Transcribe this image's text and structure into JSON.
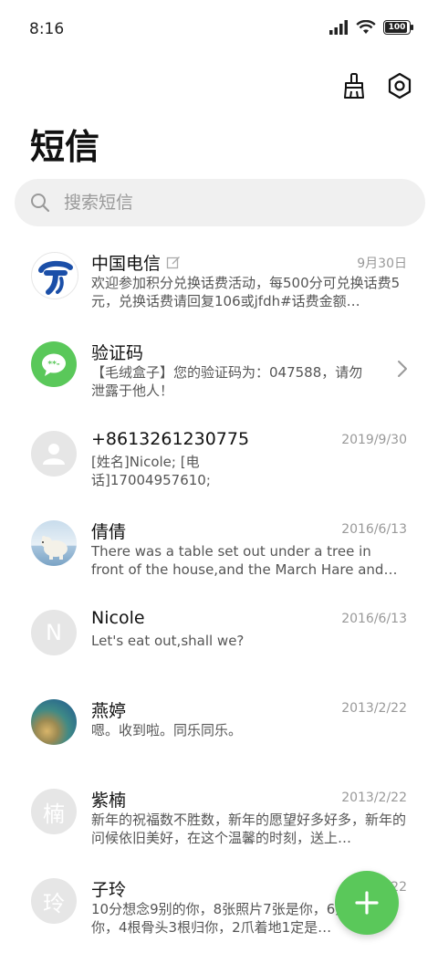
{
  "status_bar": {
    "time": "8:16",
    "battery": "100"
  },
  "header": {
    "title": "短信"
  },
  "search": {
    "placeholder": "搜索短信"
  },
  "colors": {
    "accent_green": "#5ac85a",
    "telecom_blue": "#1b4fa8"
  },
  "messages": [
    {
      "name": "中国电信",
      "date": "9月30日",
      "preview": "欢迎参加积分兑换话费活动，每500分可兑换话费5元，兑换话费请回复106或jfdh#话费金额…",
      "avatar": "china-telecom-logo"
    },
    {
      "name": "验证码",
      "date": "",
      "preview": "【毛绒盒子】您的验证码为：047588，请勿泄露于他人！",
      "avatar": "chat-bubble-icon"
    },
    {
      "name": "+8613261230775",
      "date": "2019/9/30",
      "preview": "[姓名]Nicole; [电话]17004957610;",
      "avatar": "person-icon"
    },
    {
      "name": "倩倩",
      "date": "2016/6/13",
      "preview": "There was a table set out under a tree in front of the house,and the March Hare and th…",
      "avatar": "polar-bear-photo"
    },
    {
      "name": "Nicole",
      "date": "2016/6/13",
      "preview": "Let's eat out,shall we?",
      "avatar_letter": "N"
    },
    {
      "name": "燕婷",
      "date": "2013/2/22",
      "preview": "嗯。收到啦。同乐同乐。",
      "avatar": "landscape-photo"
    },
    {
      "name": "紫楠",
      "date": "2013/2/22",
      "preview": "新年的祝福数不胜数，新年的愿望好多好多，新年的问候依旧美好，在这个温馨的时刻，送上…",
      "avatar_letter": "楠"
    },
    {
      "name": "子玲",
      "date": "2013/2/22",
      "preview": "10分想念9别的你，8张照片7张是你，6只……像你，4根骨头3根归你，2爪着地1定是…",
      "avatar_letter": "玲"
    }
  ]
}
